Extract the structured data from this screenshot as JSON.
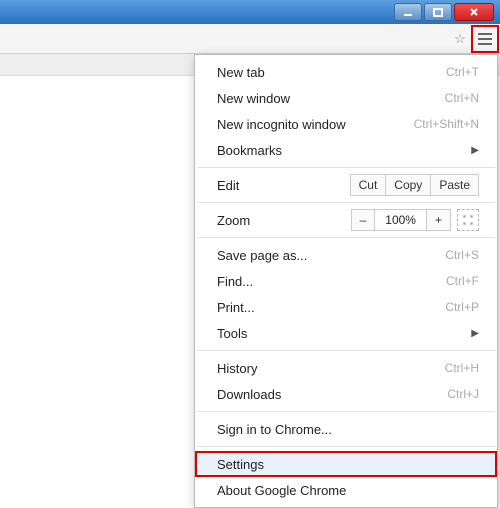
{
  "window": {
    "state": "maximized"
  },
  "toolbar": {
    "star": "☆",
    "menu": "≡"
  },
  "menu": {
    "newtab": {
      "label": "New tab",
      "shortcut": "Ctrl+T"
    },
    "newwindow": {
      "label": "New window",
      "shortcut": "Ctrl+N"
    },
    "incognito": {
      "label": "New incognito window",
      "shortcut": "Ctrl+Shift+N"
    },
    "bookmarks": {
      "label": "Bookmarks"
    },
    "edit": {
      "label": "Edit",
      "cut": "Cut",
      "copy": "Copy",
      "paste": "Paste"
    },
    "zoom": {
      "label": "Zoom",
      "minus": "–",
      "value": "100%",
      "plus": "+"
    },
    "savepage": {
      "label": "Save page as...",
      "shortcut": "Ctrl+S"
    },
    "find": {
      "label": "Find...",
      "shortcut": "Ctrl+F"
    },
    "print": {
      "label": "Print...",
      "shortcut": "Ctrl+P"
    },
    "tools": {
      "label": "Tools"
    },
    "history": {
      "label": "History",
      "shortcut": "Ctrl+H"
    },
    "downloads": {
      "label": "Downloads",
      "shortcut": "Ctrl+J"
    },
    "signin": {
      "label": "Sign in to Chrome..."
    },
    "settings": {
      "label": "Settings"
    },
    "about": {
      "label": "About Google Chrome"
    }
  }
}
